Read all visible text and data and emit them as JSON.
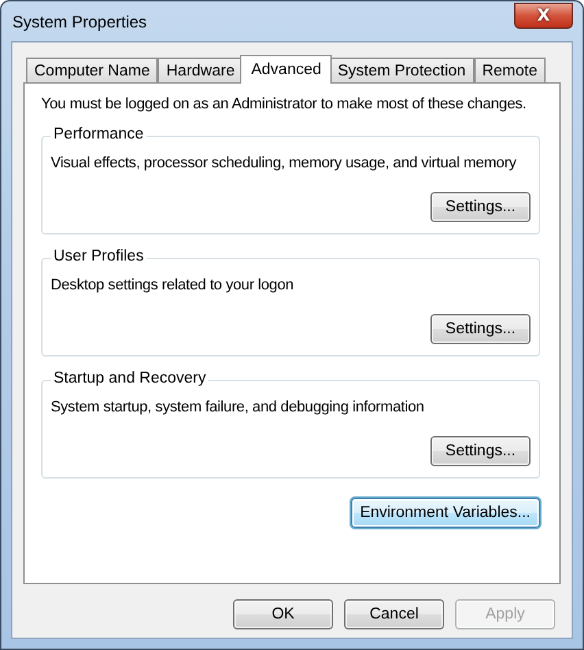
{
  "window": {
    "title": "System Properties",
    "close_label": "X"
  },
  "tabs": [
    {
      "label": "Computer Name",
      "selected": false
    },
    {
      "label": "Hardware",
      "selected": false
    },
    {
      "label": "Advanced",
      "selected": true
    },
    {
      "label": "System Protection",
      "selected": false
    },
    {
      "label": "Remote",
      "selected": false
    }
  ],
  "notice": "You must be logged on as an Administrator to make most of these changes.",
  "groups": [
    {
      "title": "Performance",
      "description": "Visual effects, processor scheduling, memory usage, and virtual memory",
      "button": "Settings..."
    },
    {
      "title": "User Profiles",
      "description": "Desktop settings related to your logon",
      "button": "Settings..."
    },
    {
      "title": "Startup and Recovery",
      "description": "System startup, system failure, and debugging information",
      "button": "Settings..."
    }
  ],
  "environment_button": {
    "label": "Environment Variables...",
    "focused": true
  },
  "buttons": [
    {
      "label": "OK",
      "disabled": false
    },
    {
      "label": "Cancel",
      "disabled": false
    },
    {
      "label": "Apply",
      "disabled": true
    }
  ]
}
